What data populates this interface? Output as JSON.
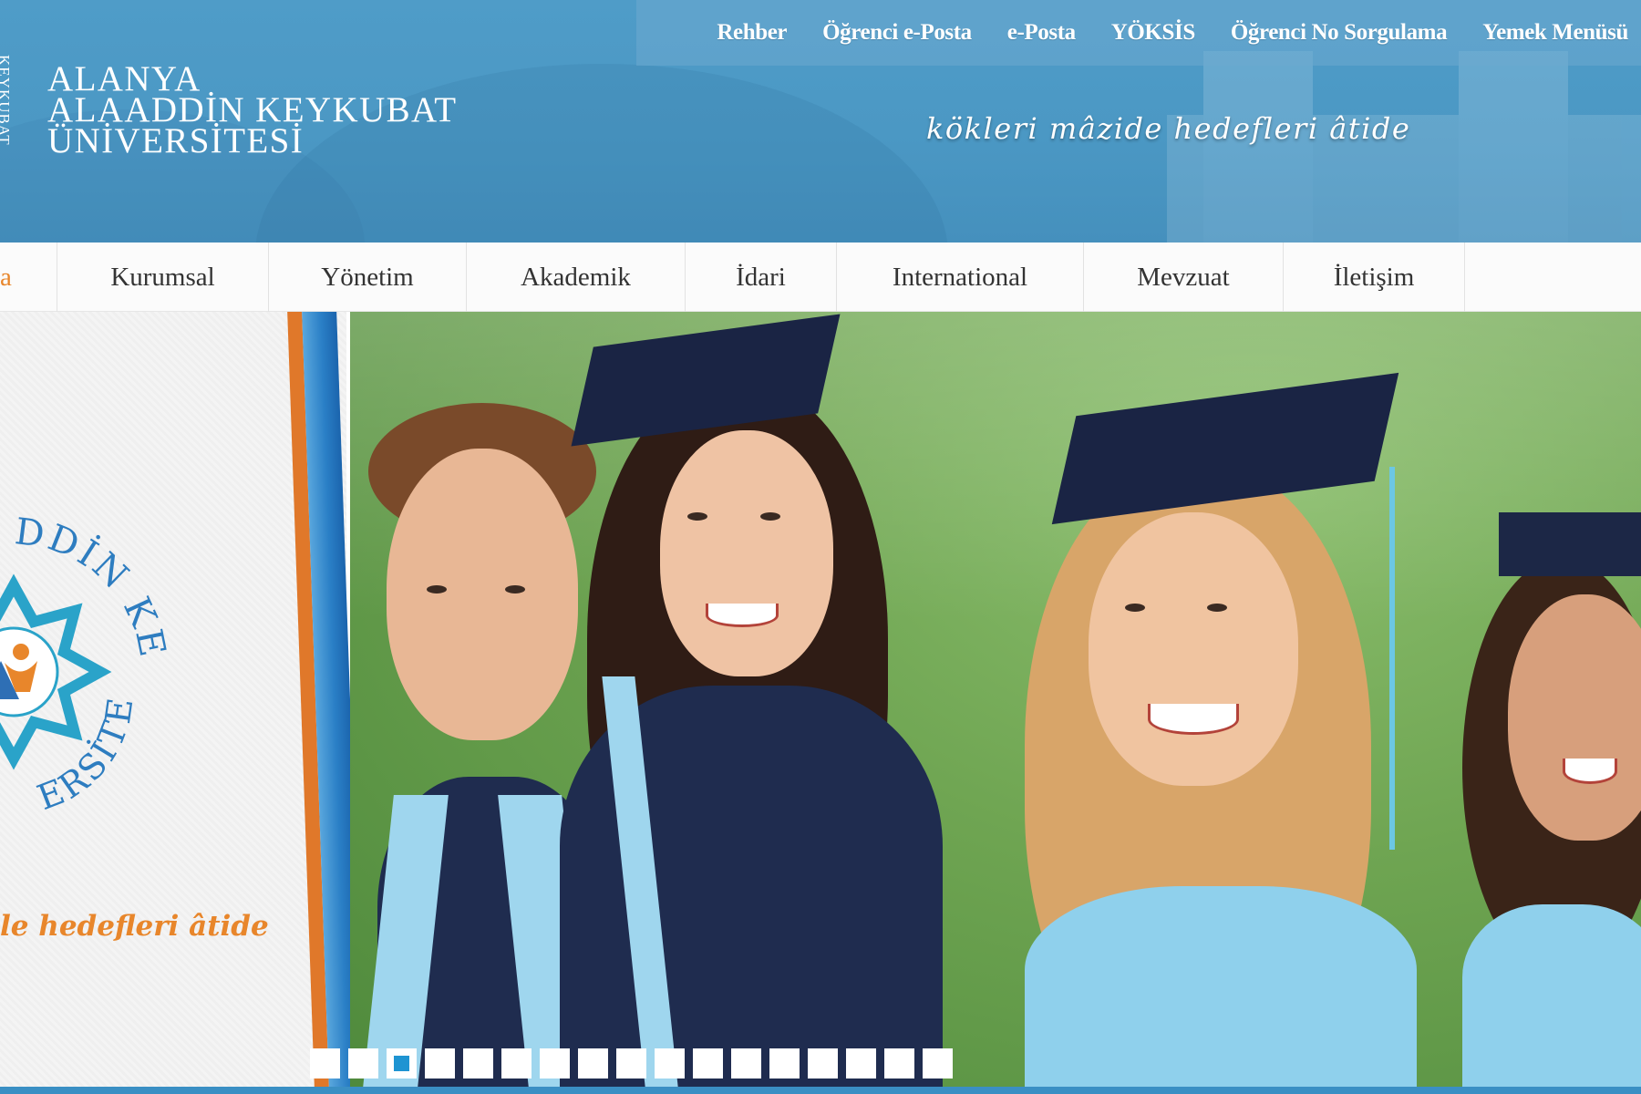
{
  "header": {
    "top_links": [
      "Rehber",
      "Öğrenci e-Posta",
      "e-Posta",
      "YÖKSİS",
      "Öğrenci No Sorgulama",
      "Yemek Menüsü"
    ],
    "seal_text": "KEYKUBAT",
    "brand_line1": "ALANYA",
    "brand_line2": "ALAADDİN KEYKUBAT",
    "brand_line3": "ÜNİVERSİTESİ",
    "slogan": "kökleri mâzide hedefleri âtide"
  },
  "nav": {
    "items": [
      {
        "label": "a",
        "active": true
      },
      {
        "label": "Kurumsal"
      },
      {
        "label": "Yönetim"
      },
      {
        "label": "Akademik"
      },
      {
        "label": "İdari"
      },
      {
        "label": "International"
      },
      {
        "label": "Mevzuat"
      },
      {
        "label": "İletişim"
      }
    ]
  },
  "slider": {
    "logo_arc_top": "DDİN KEYKUBAT",
    "logo_arc_bottom": "ERSİTESİ",
    "panel_slogan": "le hedefleri âtide",
    "slide_count": 17,
    "active_slide_index": 2
  },
  "colors": {
    "header_blue": "#4b98c4",
    "accent_orange": "#e8862b",
    "accent_blue": "#1e94d2",
    "gown_navy": "#1f2c4f",
    "sash_lightblue": "#9fd6ee"
  }
}
